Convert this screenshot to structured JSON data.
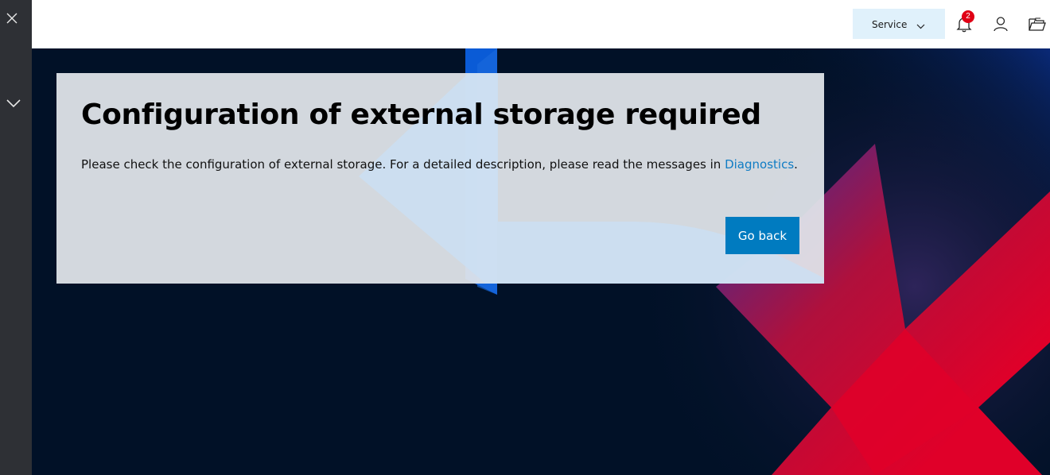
{
  "topbar": {
    "service_label": "Service",
    "notification_count": "2"
  },
  "card": {
    "title": "Configuration of external storage required",
    "message_before_link": "Please check the configuration of external storage. For a detailed description, please read the messages in ",
    "link_text": "Diagnostics",
    "message_after_link": ".",
    "button_label": "Go back"
  },
  "colors": {
    "sidebar": "#2e3035",
    "background": "#011127",
    "accent_blue": "#007bc0",
    "badge_red": "#e00015",
    "brand_red": "#e00029"
  },
  "icons": [
    "close-icon",
    "chevron-down-icon",
    "bell-icon",
    "user-icon",
    "folder-icon"
  ]
}
